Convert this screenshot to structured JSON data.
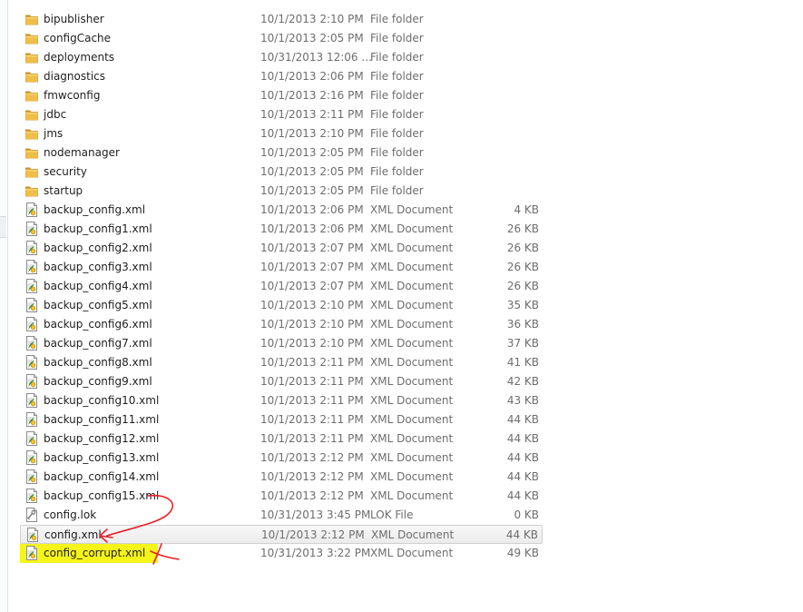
{
  "colors": {
    "folder": "#e8b53a",
    "folder_dark": "#c9922a",
    "annotation_red": "#e8202a",
    "highlight_yellow": "#f6f51a",
    "selected_border": "#d0d0d0"
  },
  "files": [
    {
      "name": "bipublisher",
      "date": "10/1/2013 2:10 PM",
      "type": "File folder",
      "size": "",
      "icon": "folder-icon"
    },
    {
      "name": "configCache",
      "date": "10/1/2013 2:05 PM",
      "type": "File folder",
      "size": "",
      "icon": "folder-icon"
    },
    {
      "name": "deployments",
      "date": "10/31/2013 12:06 ...",
      "type": "File folder",
      "size": "",
      "icon": "folder-icon"
    },
    {
      "name": "diagnostics",
      "date": "10/1/2013 2:06 PM",
      "type": "File folder",
      "size": "",
      "icon": "folder-icon"
    },
    {
      "name": "fmwconfig",
      "date": "10/1/2013 2:16 PM",
      "type": "File folder",
      "size": "",
      "icon": "folder-icon"
    },
    {
      "name": "jdbc",
      "date": "10/1/2013 2:11 PM",
      "type": "File folder",
      "size": "",
      "icon": "folder-icon"
    },
    {
      "name": "jms",
      "date": "10/1/2013 2:10 PM",
      "type": "File folder",
      "size": "",
      "icon": "folder-icon"
    },
    {
      "name": "nodemanager",
      "date": "10/1/2013 2:05 PM",
      "type": "File folder",
      "size": "",
      "icon": "folder-icon"
    },
    {
      "name": "security",
      "date": "10/1/2013 2:05 PM",
      "type": "File folder",
      "size": "",
      "icon": "folder-icon"
    },
    {
      "name": "startup",
      "date": "10/1/2013 2:05 PM",
      "type": "File folder",
      "size": "",
      "icon": "folder-icon"
    },
    {
      "name": "backup_config.xml",
      "date": "10/1/2013 2:06 PM",
      "type": "XML Document",
      "size": "4 KB",
      "icon": "xml-document-icon"
    },
    {
      "name": "backup_config1.xml",
      "date": "10/1/2013 2:06 PM",
      "type": "XML Document",
      "size": "26 KB",
      "icon": "xml-document-icon"
    },
    {
      "name": "backup_config2.xml",
      "date": "10/1/2013 2:07 PM",
      "type": "XML Document",
      "size": "26 KB",
      "icon": "xml-document-icon"
    },
    {
      "name": "backup_config3.xml",
      "date": "10/1/2013 2:07 PM",
      "type": "XML Document",
      "size": "26 KB",
      "icon": "xml-document-icon"
    },
    {
      "name": "backup_config4.xml",
      "date": "10/1/2013 2:07 PM",
      "type": "XML Document",
      "size": "26 KB",
      "icon": "xml-document-icon"
    },
    {
      "name": "backup_config5.xml",
      "date": "10/1/2013 2:10 PM",
      "type": "XML Document",
      "size": "35 KB",
      "icon": "xml-document-icon"
    },
    {
      "name": "backup_config6.xml",
      "date": "10/1/2013 2:10 PM",
      "type": "XML Document",
      "size": "36 KB",
      "icon": "xml-document-icon"
    },
    {
      "name": "backup_config7.xml",
      "date": "10/1/2013 2:10 PM",
      "type": "XML Document",
      "size": "37 KB",
      "icon": "xml-document-icon"
    },
    {
      "name": "backup_config8.xml",
      "date": "10/1/2013 2:11 PM",
      "type": "XML Document",
      "size": "41 KB",
      "icon": "xml-document-icon"
    },
    {
      "name": "backup_config9.xml",
      "date": "10/1/2013 2:11 PM",
      "type": "XML Document",
      "size": "42 KB",
      "icon": "xml-document-icon"
    },
    {
      "name": "backup_config10.xml",
      "date": "10/1/2013 2:11 PM",
      "type": "XML Document",
      "size": "43 KB",
      "icon": "xml-document-icon"
    },
    {
      "name": "backup_config11.xml",
      "date": "10/1/2013 2:11 PM",
      "type": "XML Document",
      "size": "44 KB",
      "icon": "xml-document-icon"
    },
    {
      "name": "backup_config12.xml",
      "date": "10/1/2013 2:11 PM",
      "type": "XML Document",
      "size": "44 KB",
      "icon": "xml-document-icon"
    },
    {
      "name": "backup_config13.xml",
      "date": "10/1/2013 2:12 PM",
      "type": "XML Document",
      "size": "44 KB",
      "icon": "xml-document-icon"
    },
    {
      "name": "backup_config14.xml",
      "date": "10/1/2013 2:12 PM",
      "type": "XML Document",
      "size": "44 KB",
      "icon": "xml-document-icon"
    },
    {
      "name": "backup_config15.xml",
      "date": "10/1/2013 2:12 PM",
      "type": "XML Document",
      "size": "44 KB",
      "icon": "xml-document-icon"
    },
    {
      "name": "config.lok",
      "date": "10/31/2013 3:45 PM",
      "type": "LOK File",
      "size": "0 KB",
      "icon": "lok-file-icon"
    },
    {
      "name": "config.xml",
      "date": "10/1/2013 2:12 PM",
      "type": "XML Document",
      "size": "44 KB",
      "icon": "xml-document-icon",
      "selected": true
    },
    {
      "name": "config_corrupt.xml",
      "date": "10/31/2013 3:22 PM",
      "type": "XML Document",
      "size": "49 KB",
      "icon": "xml-document-icon",
      "highlighted": true
    }
  ]
}
